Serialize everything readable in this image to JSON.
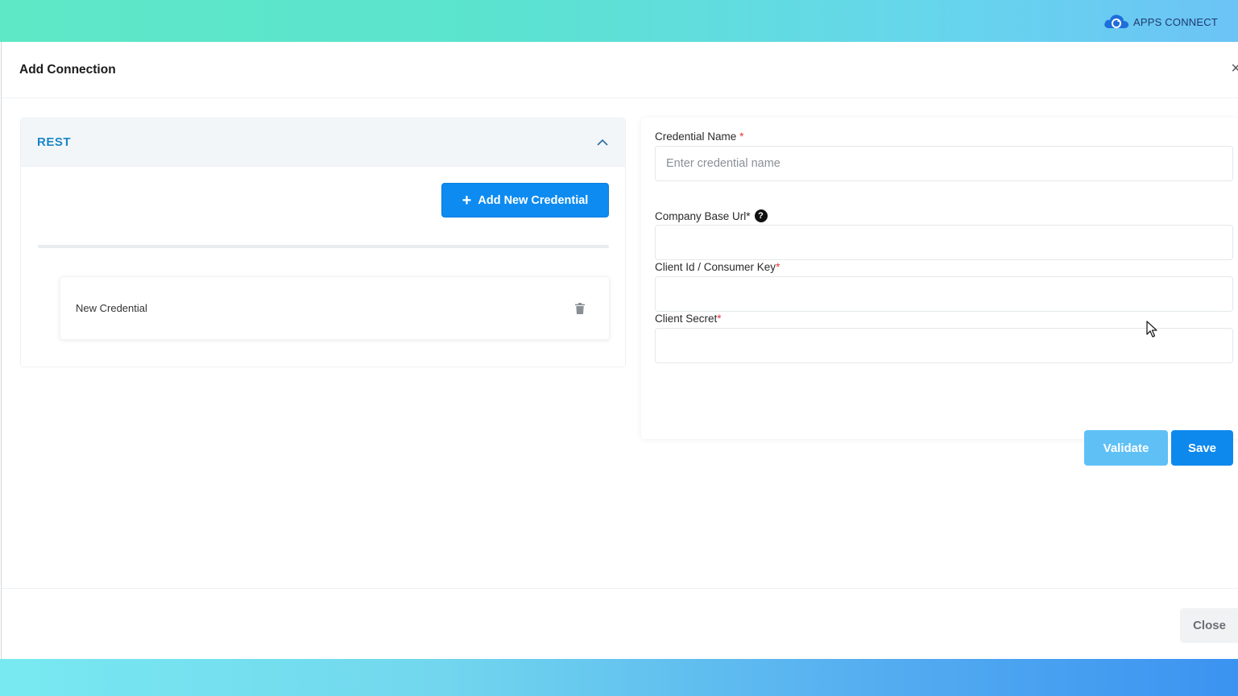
{
  "brand": {
    "name": "APPS CONNECT",
    "logo_icon": "cloud-sync-icon"
  },
  "modal": {
    "title": "Add Connection",
    "close_icon": "close-icon"
  },
  "left_panel": {
    "section_title": "REST",
    "toggle_icon": "chevron-up-icon",
    "add_button_label": "Add New Credential",
    "add_button_icon": "plus-icon",
    "credentials": [
      {
        "name": "New Credential",
        "delete_icon": "trash-icon"
      }
    ]
  },
  "form": {
    "credential_name": {
      "label": "Credential Name",
      "required_mark": "*",
      "placeholder": "Enter credential name",
      "value": ""
    },
    "company_base_url": {
      "label": "Company Base Url*",
      "help_icon": "help-icon",
      "value": ""
    },
    "client_id": {
      "label": "Client Id / Consumer Key",
      "required_mark": "*",
      "value": ""
    },
    "client_secret": {
      "label": "Client Secret",
      "required_mark": "*",
      "value": ""
    },
    "validate_label": "Validate",
    "save_label": "Save"
  },
  "footer": {
    "close_label": "Close"
  },
  "colors": {
    "primary": "#0d89ee",
    "validate": "#5fc0f5",
    "section_title": "#1a86c8",
    "required": "#e5353b"
  }
}
